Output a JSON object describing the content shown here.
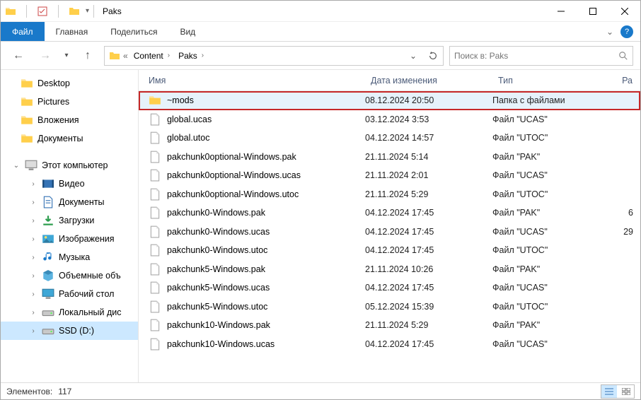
{
  "window": {
    "title": "Paks"
  },
  "ribbon": {
    "file": "Файл",
    "tabs": [
      "Главная",
      "Поделиться",
      "Вид"
    ]
  },
  "nav": {
    "breadcrumbs": [
      "Content",
      "Paks"
    ],
    "chevron_prefix": "«"
  },
  "search": {
    "placeholder": "Поиск в: Paks"
  },
  "sidebar": {
    "quick": [
      {
        "label": "Desktop",
        "icon": "folder"
      },
      {
        "label": "Pictures",
        "icon": "folder"
      },
      {
        "label": "Вложения",
        "icon": "folder"
      },
      {
        "label": "Документы",
        "icon": "folder"
      }
    ],
    "thispc": {
      "label": "Этот компьютер",
      "children": [
        {
          "label": "Видео",
          "icon": "video"
        },
        {
          "label": "Документы",
          "icon": "docs"
        },
        {
          "label": "Загрузки",
          "icon": "downloads"
        },
        {
          "label": "Изображения",
          "icon": "images"
        },
        {
          "label": "Музыка",
          "icon": "music"
        },
        {
          "label": "Объемные объ",
          "icon": "3d"
        },
        {
          "label": "Рабочий стол",
          "icon": "desktop"
        },
        {
          "label": "Локальный дис",
          "icon": "disk"
        },
        {
          "label": "SSD (D:)",
          "icon": "disk",
          "selected": true
        }
      ]
    }
  },
  "columns": {
    "name": "Имя",
    "date": "Дата изменения",
    "type": "Тип",
    "size": "Ра"
  },
  "files": [
    {
      "name": "~mods",
      "date": "08.12.2024 20:50",
      "type": "Папка с файлами",
      "size": "",
      "icon": "folder",
      "highlight": true
    },
    {
      "name": "global.ucas",
      "date": "03.12.2024 3:53",
      "type": "Файл \"UCAS\"",
      "size": "",
      "icon": "file"
    },
    {
      "name": "global.utoc",
      "date": "04.12.2024 14:57",
      "type": "Файл \"UTOC\"",
      "size": "",
      "icon": "file"
    },
    {
      "name": "pakchunk0optional-Windows.pak",
      "date": "21.11.2024 5:14",
      "type": "Файл \"PAK\"",
      "size": "",
      "icon": "file"
    },
    {
      "name": "pakchunk0optional-Windows.ucas",
      "date": "21.11.2024 2:01",
      "type": "Файл \"UCAS\"",
      "size": "",
      "icon": "file"
    },
    {
      "name": "pakchunk0optional-Windows.utoc",
      "date": "21.11.2024 5:29",
      "type": "Файл \"UTOC\"",
      "size": "",
      "icon": "file"
    },
    {
      "name": "pakchunk0-Windows.pak",
      "date": "04.12.2024 17:45",
      "type": "Файл \"PAK\"",
      "size": "6",
      "icon": "file"
    },
    {
      "name": "pakchunk0-Windows.ucas",
      "date": "04.12.2024 17:45",
      "type": "Файл \"UCAS\"",
      "size": "29",
      "icon": "file"
    },
    {
      "name": "pakchunk0-Windows.utoc",
      "date": "04.12.2024 17:45",
      "type": "Файл \"UTOC\"",
      "size": "",
      "icon": "file"
    },
    {
      "name": "pakchunk5-Windows.pak",
      "date": "21.11.2024 10:26",
      "type": "Файл \"PAK\"",
      "size": "",
      "icon": "file"
    },
    {
      "name": "pakchunk5-Windows.ucas",
      "date": "04.12.2024 17:45",
      "type": "Файл \"UCAS\"",
      "size": "",
      "icon": "file"
    },
    {
      "name": "pakchunk5-Windows.utoc",
      "date": "05.12.2024 15:39",
      "type": "Файл \"UTOC\"",
      "size": "",
      "icon": "file"
    },
    {
      "name": "pakchunk10-Windows.pak",
      "date": "21.11.2024 5:29",
      "type": "Файл \"PAK\"",
      "size": "",
      "icon": "file"
    },
    {
      "name": "pakchunk10-Windows.ucas",
      "date": "04.12.2024 17:45",
      "type": "Файл \"UCAS\"",
      "size": "",
      "icon": "file"
    }
  ],
  "status": {
    "items_label": "Элементов:",
    "items_count": "117"
  }
}
